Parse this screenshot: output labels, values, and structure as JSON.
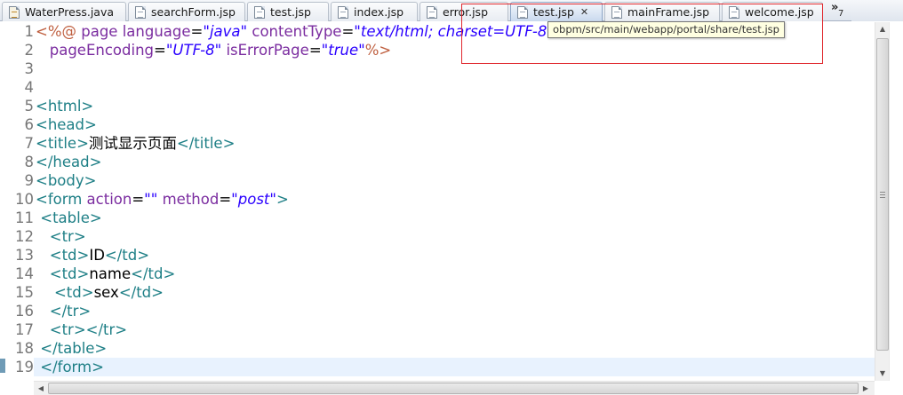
{
  "tabs": [
    {
      "label": "WaterPress.java",
      "kind": "java",
      "active": false
    },
    {
      "label": "searchForm.jsp",
      "kind": "jsp",
      "active": false
    },
    {
      "label": "test.jsp",
      "kind": "jsp",
      "active": false
    },
    {
      "label": "index.jsp",
      "kind": "jsp",
      "active": false
    },
    {
      "label": "error.jsp",
      "kind": "jsp",
      "active": false
    },
    {
      "label": "test.jsp",
      "kind": "jsp",
      "active": true,
      "close_icon": "✕"
    },
    {
      "label": "mainFrame.jsp",
      "kind": "jsp",
      "active": false
    },
    {
      "label": "welcome.jsp",
      "kind": "jsp",
      "active": false
    }
  ],
  "overflow": {
    "chevron": "»",
    "count": "7"
  },
  "tooltip": {
    "text": "obpm/src/main/webapp/portal/share/test.jsp"
  },
  "editor": {
    "current_line": "19",
    "line_numbers": [
      "1",
      "2",
      "3",
      "4",
      "5",
      "6",
      "7",
      "8",
      "9",
      "10",
      "11",
      "12",
      "13",
      "14",
      "15",
      "16",
      "17",
      "18",
      "19"
    ],
    "lines": [
      {
        "tokens": [
          {
            "c": "d",
            "t": "<%@ "
          },
          {
            "c": "a",
            "t": "page "
          },
          {
            "c": "a",
            "t": "language"
          },
          {
            "c": "x",
            "t": "="
          },
          {
            "c": "v",
            "t": "\"java\""
          },
          {
            "c": "x",
            "t": " "
          },
          {
            "c": "a",
            "t": "contentType"
          },
          {
            "c": "x",
            "t": "="
          },
          {
            "c": "v",
            "t": "\"text/html; charset=UTF-8\""
          }
        ]
      },
      {
        "tokens": [
          {
            "c": "x",
            "t": "   "
          },
          {
            "c": "a",
            "t": "pageEncoding"
          },
          {
            "c": "x",
            "t": "="
          },
          {
            "c": "v",
            "t": "\"UTF-8\""
          },
          {
            "c": "x",
            "t": " "
          },
          {
            "c": "a",
            "t": "isErrorPage"
          },
          {
            "c": "x",
            "t": "="
          },
          {
            "c": "v",
            "t": "\"true\""
          },
          {
            "c": "d",
            "t": "%>"
          }
        ]
      },
      {
        "tokens": []
      },
      {
        "tokens": []
      },
      {
        "tokens": [
          {
            "c": "t",
            "t": "<html>"
          }
        ]
      },
      {
        "tokens": [
          {
            "c": "t",
            "t": "<head>"
          }
        ]
      },
      {
        "tokens": [
          {
            "c": "t",
            "t": "<title>"
          },
          {
            "c": "x",
            "t": "测试显示页面"
          },
          {
            "c": "t",
            "t": "</title>"
          }
        ]
      },
      {
        "tokens": [
          {
            "c": "t",
            "t": "</head>"
          }
        ]
      },
      {
        "tokens": [
          {
            "c": "t",
            "t": "<body>"
          }
        ]
      },
      {
        "tokens": [
          {
            "c": "t",
            "t": "<form "
          },
          {
            "c": "a",
            "t": "action"
          },
          {
            "c": "x",
            "t": "="
          },
          {
            "c": "v",
            "t": "\"\""
          },
          {
            "c": "x",
            "t": " "
          },
          {
            "c": "a",
            "t": "method"
          },
          {
            "c": "x",
            "t": "="
          },
          {
            "c": "v",
            "t": "\"post\""
          },
          {
            "c": "t",
            "t": ">"
          }
        ]
      },
      {
        "tokens": [
          {
            "c": "x",
            "t": " "
          },
          {
            "c": "t",
            "t": "<table>"
          }
        ]
      },
      {
        "tokens": [
          {
            "c": "x",
            "t": "   "
          },
          {
            "c": "t",
            "t": "<tr>"
          }
        ]
      },
      {
        "tokens": [
          {
            "c": "x",
            "t": "   "
          },
          {
            "c": "t",
            "t": "<td>"
          },
          {
            "c": "x",
            "t": "ID"
          },
          {
            "c": "t",
            "t": "</td>"
          }
        ]
      },
      {
        "tokens": [
          {
            "c": "x",
            "t": "   "
          },
          {
            "c": "t",
            "t": "<td>"
          },
          {
            "c": "x",
            "t": "name"
          },
          {
            "c": "t",
            "t": "</td>"
          }
        ]
      },
      {
        "tokens": [
          {
            "c": "x",
            "t": "    "
          },
          {
            "c": "t",
            "t": "<td>"
          },
          {
            "c": "x",
            "t": "sex"
          },
          {
            "c": "t",
            "t": "</td>"
          }
        ]
      },
      {
        "tokens": [
          {
            "c": "x",
            "t": "   "
          },
          {
            "c": "t",
            "t": "</tr>"
          }
        ]
      },
      {
        "tokens": [
          {
            "c": "x",
            "t": "   "
          },
          {
            "c": "t",
            "t": "<tr></tr>"
          }
        ]
      },
      {
        "tokens": [
          {
            "c": "x",
            "t": " "
          },
          {
            "c": "t",
            "t": "</table>"
          }
        ]
      },
      {
        "tokens": [
          {
            "c": "x",
            "t": " "
          },
          {
            "c": "t",
            "t": "</form>"
          }
        ]
      }
    ]
  },
  "colors": {
    "tag": "#1e7f86",
    "attribute": "#7b2da0",
    "value": "#2a00ff",
    "current_line": "#e8f2fe",
    "highlight_box": "#e0282e",
    "tooltip_bg": "#ffffe1"
  }
}
